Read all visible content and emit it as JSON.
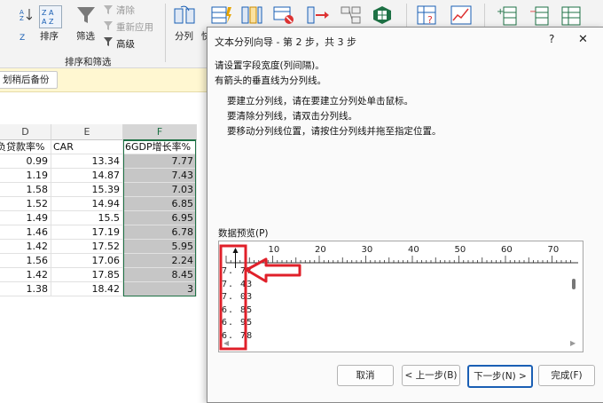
{
  "ribbon": {
    "sort_label": "排序",
    "filter_label": "筛选",
    "clear_label": "清除",
    "reapply_label": "重新应用",
    "advanced_label": "高级",
    "group_label": "排序和筛选",
    "split_label": "分列",
    "partial_label": "快"
  },
  "infobar": {
    "button_label": "划稍后备份"
  },
  "sheet": {
    "columns": [
      "D",
      "E",
      "F"
    ],
    "headers": [
      "负贷款率%",
      "CAR",
      "6GDP增长率%"
    ],
    "rows": [
      [
        "0.99",
        "13.34",
        "7.77"
      ],
      [
        "1.19",
        "14.87",
        "7.43"
      ],
      [
        "1.58",
        "15.39",
        "7.03"
      ],
      [
        "1.52",
        "14.94",
        "6.85"
      ],
      [
        "1.49",
        "15.5",
        "6.95"
      ],
      [
        "1.46",
        "17.19",
        "6.78"
      ],
      [
        "1.42",
        "17.52",
        "5.95"
      ],
      [
        "1.56",
        "17.06",
        "2.24"
      ],
      [
        "1.42",
        "17.85",
        "8.45"
      ],
      [
        "1.38",
        "18.42",
        "3"
      ]
    ]
  },
  "dialog": {
    "title": "文本分列向导 - 第 2 步，共 3 步",
    "help": "?",
    "close": "✕",
    "instruction1": "请设置字段宽度(列间隔)。",
    "instruction2": "有箭头的垂直线为分列线。",
    "bullet1": "要建立分列线，请在要建立分列处单击鼠标。",
    "bullet2": "要清除分列线，请双击分列线。",
    "bullet3": "要移动分列线位置，请按住分列线并拖至指定位置。",
    "preview_label": "数据预览(P)",
    "ruler_ticks": [
      "10",
      "20",
      "30",
      "40",
      "50",
      "60",
      "70"
    ],
    "preview_lines": [
      "7.77",
      "7.43",
      "7.03",
      "6.85",
      "6.95",
      "6.78"
    ],
    "cancel": "取消",
    "back": "< 上一步(B)",
    "next": "下一步(N) >",
    "finish": "完成(F)"
  },
  "colors": {
    "annotation_red": "#e0202a",
    "header_green": "#1e7145"
  }
}
